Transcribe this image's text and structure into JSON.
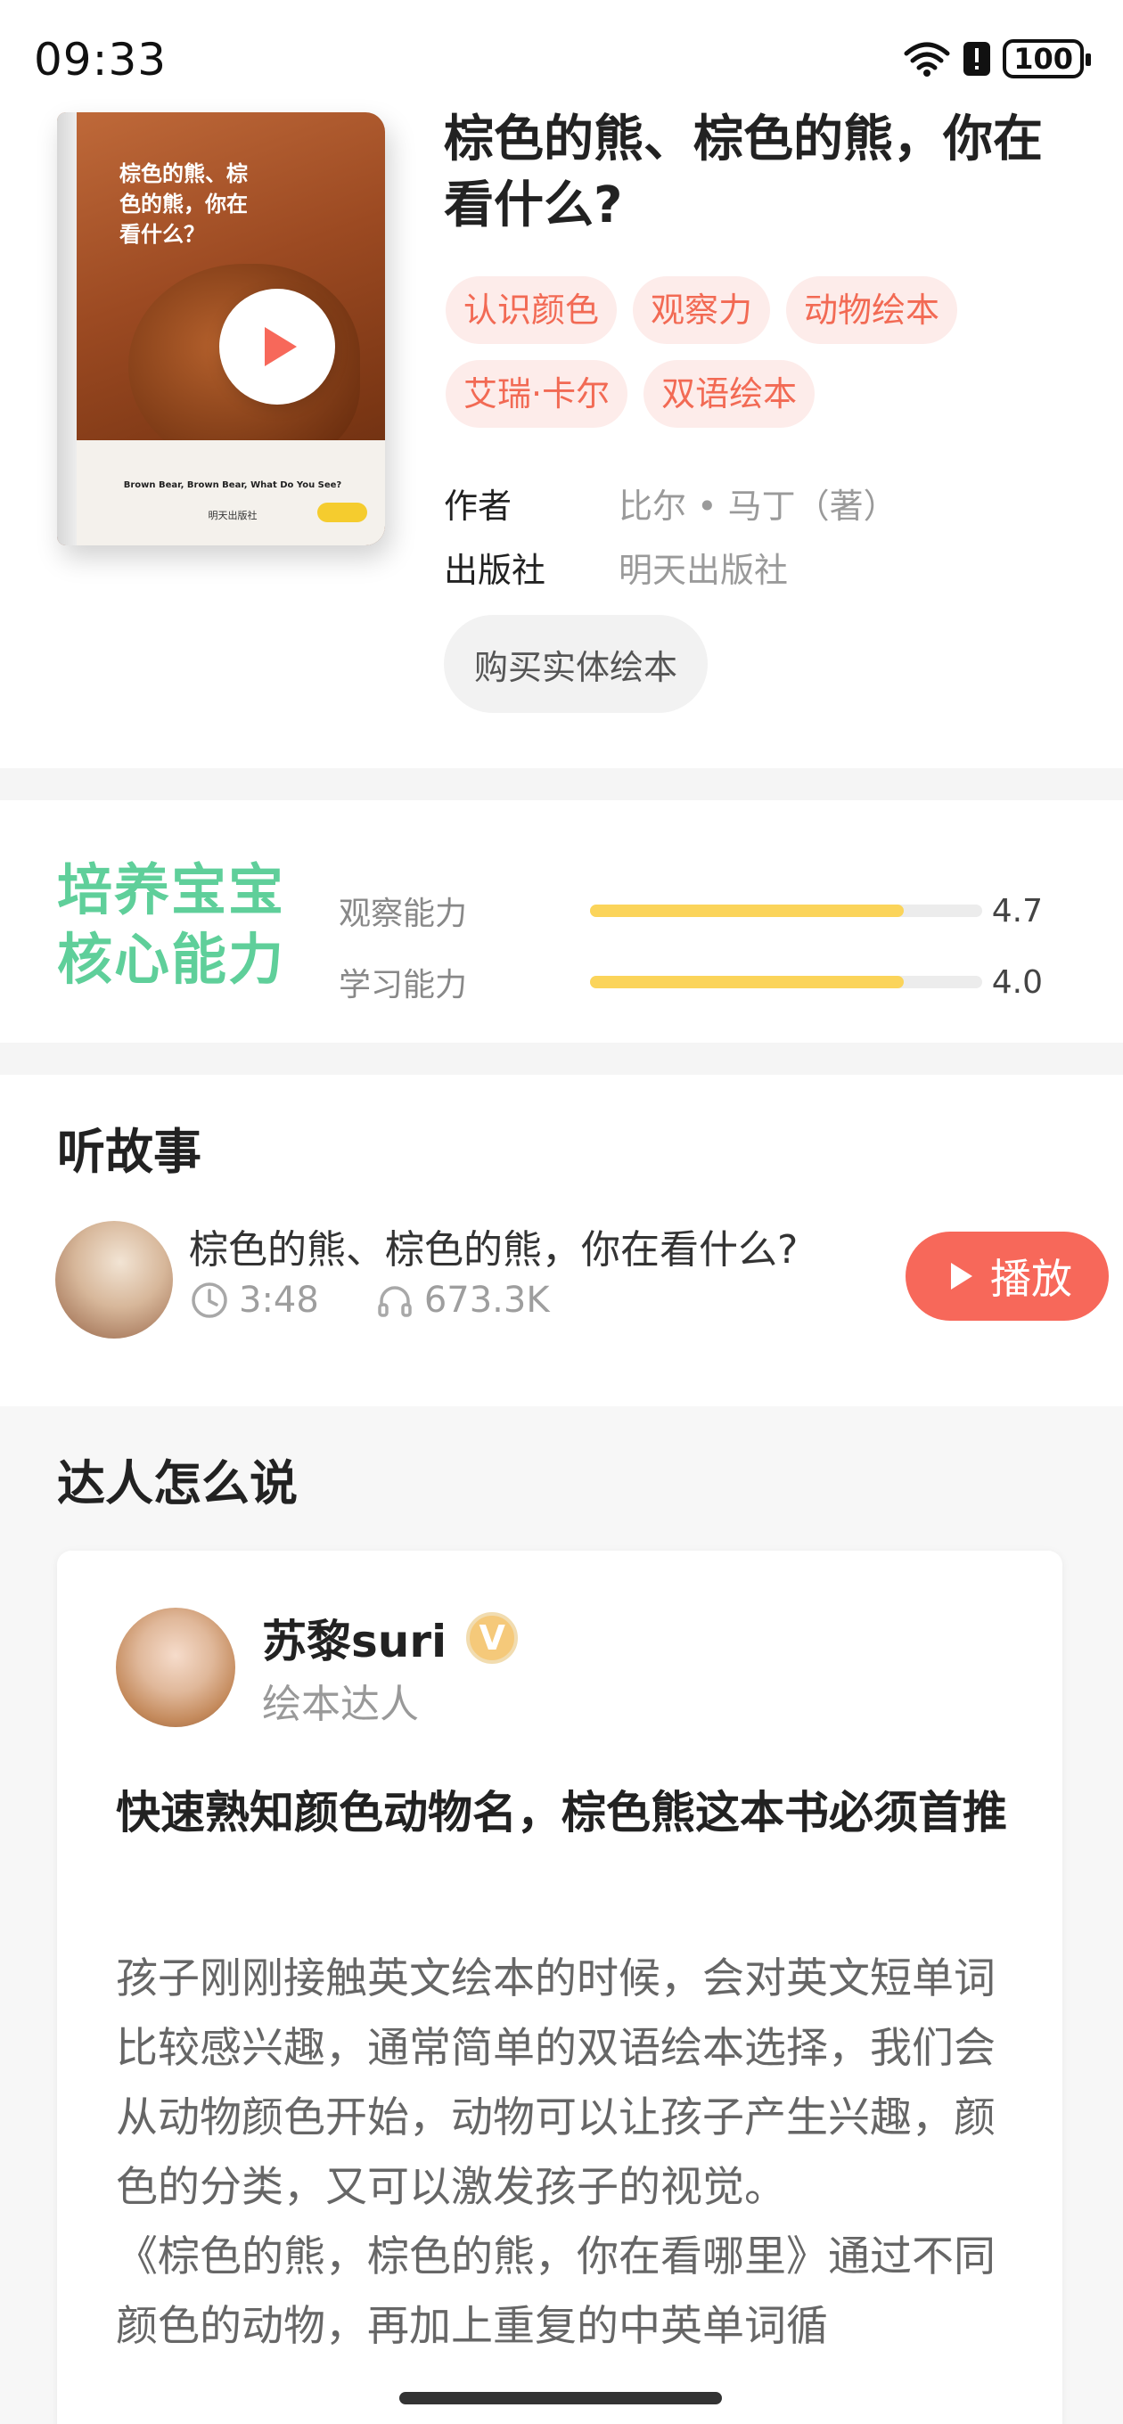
{
  "status_bar": {
    "time": "09:33",
    "battery": "100"
  },
  "book": {
    "cover_title": "棕色的熊、棕色的熊，你在看什么？",
    "cover_subtitle_en": "Brown Bear, Brown Bear, What Do You See?",
    "cover_publisher": "明天出版社",
    "title": "棕色的熊、棕色的熊，你在看什么?",
    "tags": [
      "认识颜色",
      "观察力",
      "动物绘本",
      "艾瑞·卡尔",
      "双语绘本"
    ],
    "author_label": "作者",
    "author_value": "比尔 • 马丁（著）",
    "publisher_label": "出版社",
    "publisher_value": "明天出版社",
    "buy_label": "购买实体绘本"
  },
  "abilities": {
    "title_line1": "培养宝宝",
    "title_line2": "核心能力",
    "items": [
      {
        "label": "观察能力",
        "value": "4.7",
        "fill": 0.8
      },
      {
        "label": "学习能力",
        "value": "4.0",
        "fill": 0.8
      }
    ]
  },
  "listen": {
    "section_title": "听故事",
    "story_name": "棕色的熊、棕色的熊，你在看什么?",
    "duration": "3:48",
    "plays": "673.3K",
    "play_label": "播放"
  },
  "experts": {
    "section_title": "达人怎么说",
    "name": "苏黎suri",
    "badge": "V",
    "role": "绘本达人",
    "headline": "快速熟知颜色动物名，棕色熊这本书必须首推",
    "body_p1": "孩子刚刚接触英文绘本的时候，会对英文短单词比较感兴趣，通常简单的双语绘本选择，我们会从动物颜色开始，动物可以让孩子产生兴趣，颜色的分类，又可以激发孩子的视觉。",
    "body_p2": "《棕色的熊，棕色的熊，你在看哪里》通过不同颜色的动物，再加上重复的中英单词循"
  },
  "colors": {
    "accent_red": "#f7685a",
    "tag_text": "#f26a54",
    "green_title": "#5fcf9a",
    "bar_fill": "#fbd45a"
  }
}
